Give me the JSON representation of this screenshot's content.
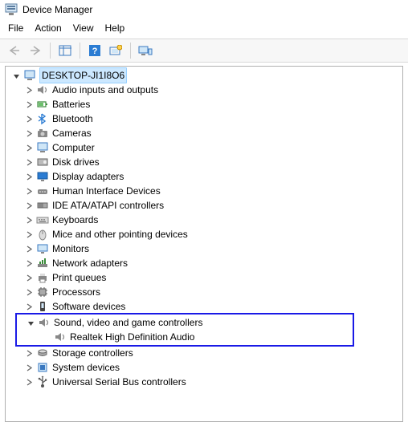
{
  "window": {
    "title": "Device Manager"
  },
  "menu": {
    "file": "File",
    "action": "Action",
    "view": "View",
    "help": "Help"
  },
  "tree": {
    "root": "DESKTOP-JI1I8O6",
    "categories": [
      {
        "label": "Audio inputs and outputs",
        "icon": "speaker"
      },
      {
        "label": "Batteries",
        "icon": "battery"
      },
      {
        "label": "Bluetooth",
        "icon": "bluetooth"
      },
      {
        "label": "Cameras",
        "icon": "camera"
      },
      {
        "label": "Computer",
        "icon": "computer"
      },
      {
        "label": "Disk drives",
        "icon": "disk"
      },
      {
        "label": "Display adapters",
        "icon": "display"
      },
      {
        "label": "Human Interface Devices",
        "icon": "hid"
      },
      {
        "label": "IDE ATA/ATAPI controllers",
        "icon": "ide"
      },
      {
        "label": "Keyboards",
        "icon": "keyboard"
      },
      {
        "label": "Mice and other pointing devices",
        "icon": "mouse"
      },
      {
        "label": "Monitors",
        "icon": "monitor"
      },
      {
        "label": "Network adapters",
        "icon": "network"
      },
      {
        "label": "Print queues",
        "icon": "printer"
      },
      {
        "label": "Processors",
        "icon": "cpu"
      },
      {
        "label": "Software devices",
        "icon": "software"
      },
      {
        "label": "Sound, video and game controllers",
        "icon": "speaker",
        "expanded": true,
        "children": [
          {
            "label": "Realtek High Definition Audio",
            "icon": "speaker"
          }
        ],
        "highlighted": true
      },
      {
        "label": "Storage controllers",
        "icon": "storage"
      },
      {
        "label": "System devices",
        "icon": "system"
      },
      {
        "label": "Universal Serial Bus controllers",
        "icon": "usb"
      }
    ]
  }
}
